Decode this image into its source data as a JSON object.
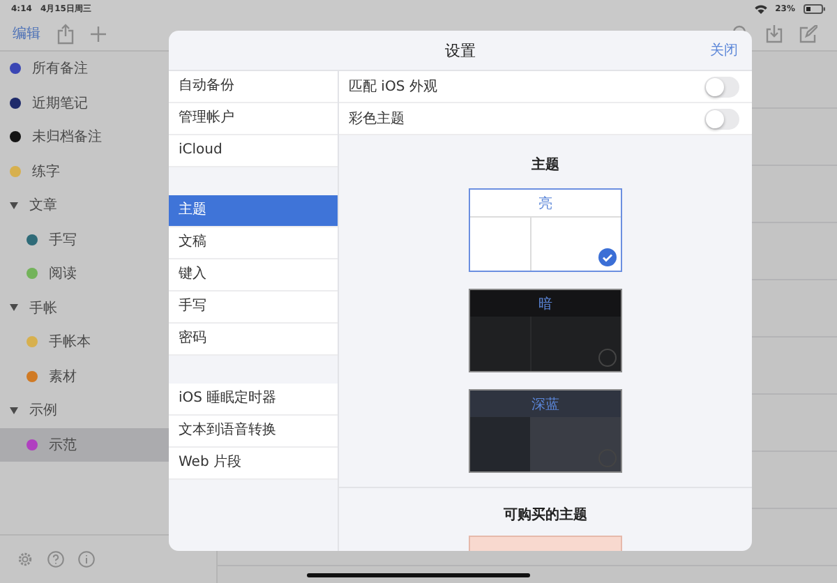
{
  "status_bar": {
    "time": "4:14",
    "date": "4月15日周三",
    "battery": "23%"
  },
  "toolbar": {
    "edit": "编辑"
  },
  "sidebar": {
    "items": [
      {
        "kind": "tag",
        "label": "所有备注",
        "color": "#3a46b4",
        "selected": false
      },
      {
        "kind": "tag",
        "label": "近期笔记",
        "color": "#1e2a6a",
        "selected": false
      },
      {
        "kind": "tag",
        "label": "未归档备注",
        "color": "#141414",
        "selected": false
      },
      {
        "kind": "tag",
        "label": "练字",
        "color": "#d7b04e",
        "selected": false
      },
      {
        "kind": "group",
        "label": "文章",
        "expanded": true,
        "children": [
          {
            "kind": "tag",
            "label": "手写",
            "color": "#2f6b78",
            "selected": false
          },
          {
            "kind": "tag",
            "label": "阅读",
            "color": "#73b35a",
            "selected": false
          }
        ]
      },
      {
        "kind": "group",
        "label": "手帐",
        "expanded": true,
        "children": [
          {
            "kind": "tag",
            "label": "手帐本",
            "color": "#d7b04e",
            "selected": false
          },
          {
            "kind": "tag",
            "label": "素材",
            "color": "#d07a24",
            "selected": false
          }
        ]
      },
      {
        "kind": "group",
        "label": "示例",
        "expanded": true,
        "children": [
          {
            "kind": "tag",
            "label": "示范",
            "color": "#b040c0",
            "selected": true
          }
        ]
      }
    ]
  },
  "settings": {
    "title": "设置",
    "close": "关闭",
    "menu_groups": [
      [
        {
          "label": "自动备份",
          "selected": false
        },
        {
          "label": "管理帐户",
          "selected": false
        },
        {
          "label": "iCloud",
          "selected": false
        }
      ],
      [
        {
          "label": "主题",
          "selected": true
        },
        {
          "label": "文稿",
          "selected": false
        },
        {
          "label": "键入",
          "selected": false
        },
        {
          "label": "手写",
          "selected": false
        },
        {
          "label": "密码",
          "selected": false
        }
      ],
      [
        {
          "label": "iOS 睡眠定时器",
          "selected": false
        },
        {
          "label": "文本到语音转换",
          "selected": false
        },
        {
          "label": "Web 片段",
          "selected": false
        }
      ]
    ],
    "switches": [
      {
        "label": "匹配 iOS 外观",
        "on": false
      },
      {
        "label": "彩色主题",
        "on": false
      }
    ],
    "themes_heading": "主题",
    "themes": [
      {
        "kind": "light",
        "label": "亮",
        "selected": true
      },
      {
        "kind": "dark",
        "label": "暗",
        "selected": false
      },
      {
        "kind": "navy",
        "label": "深蓝",
        "selected": false
      }
    ],
    "purchasable_heading": "可购买的主题"
  }
}
